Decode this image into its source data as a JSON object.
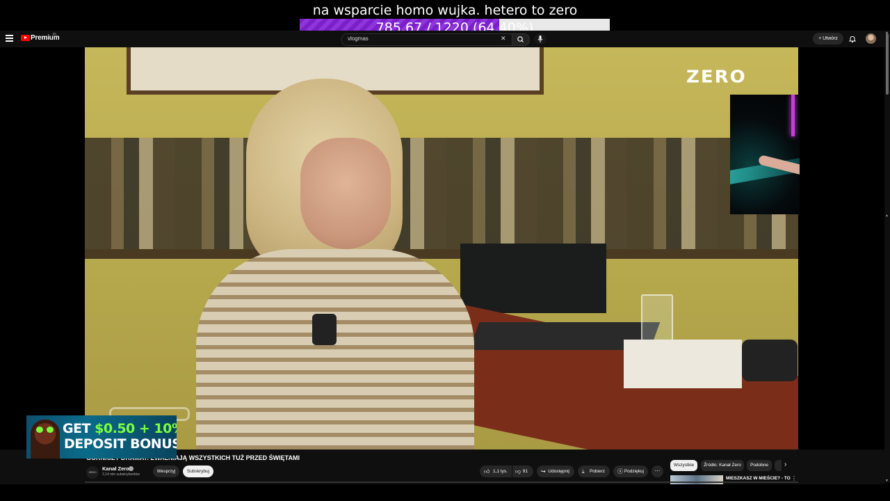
{
  "overlay": {
    "title": "na wsparcie homo wujka. hetero to zero",
    "goal_text": "785.67 / 1220 (64.40%)",
    "goal_progress": 0.644
  },
  "header": {
    "premium_label": "Premium",
    "region": "PL",
    "search_value": "vlogmas",
    "search_clear": "✕",
    "create_label": "Utwórz"
  },
  "video": {
    "logo": "ZERO"
  },
  "promo": {
    "line1_prefix": "GET",
    "line1_highlight": "$0.50 + 10%",
    "line2": "DEPOSIT BONUS"
  },
  "meta": {
    "title": "GÓRNICZY DRAMAT: ZWALNIAJĄ WSZYSTKICH TUŻ PRZED ŚWIĘTAMI",
    "channel_avatar_text": "ZERO",
    "channel_name": "Kanał Zero",
    "channel_subs": "2,14 mln subskrybentów",
    "support_label": "Wesprzyj",
    "subscribe_label": "Subskrybuj",
    "likes": "1,1 tys.",
    "dislikes": "91",
    "share_label": "Udostępnij",
    "download_label": "Pobierz",
    "thanks_label": "Podziękuj",
    "more_label": "⋯"
  },
  "sidebar": {
    "chips": [
      "Wszystkie",
      "Źródło: Kanał Zero",
      "Podobne"
    ],
    "rec_title": "MIESZKASZ W MIEŚCIE? - TO",
    "more": "⋮"
  },
  "colors": {
    "accent_red": "#ff0000",
    "goal_purple": "#7a1fc9",
    "promo_green": "#7bff3d",
    "background": "#0f0f0f"
  }
}
